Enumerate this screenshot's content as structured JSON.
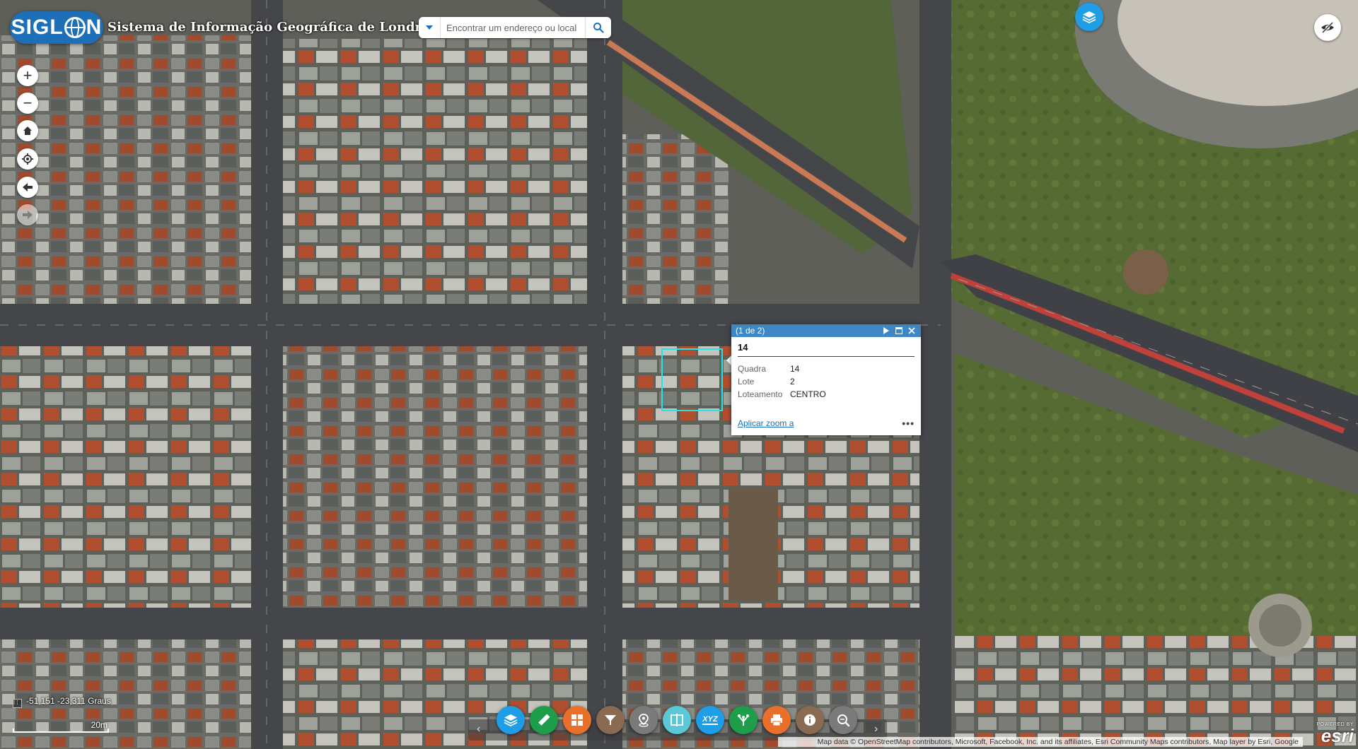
{
  "app": {
    "logo_text_left": "SIGL",
    "logo_text_right": "N",
    "title": "Sistema de Informação Geográfica de Londrina"
  },
  "search": {
    "placeholder": "Encontrar um endereço ou local",
    "value": ""
  },
  "nav": {
    "zoom_in": "+",
    "zoom_out": "−"
  },
  "popup": {
    "count": "(1 de 2)",
    "title": "14",
    "fields": [
      {
        "label": "Quadra",
        "value": "14"
      },
      {
        "label": "Lote",
        "value": "2"
      },
      {
        "label": "Loteamento",
        "value": "CENTRO"
      }
    ],
    "zoom_link": "Aplicar zoom a",
    "more": "•••"
  },
  "toolbar": {
    "colors": {
      "layers": "#1f9ee8",
      "measure": "#1e9d4a",
      "basemap": "#e8702a",
      "filter": "#8a6a50",
      "location": "#7a7a7a",
      "compare": "#5bc8d8",
      "xyz": "#1f9ee8",
      "share": "#1e9d4a",
      "print": "#e8702a",
      "info": "#8a6a50",
      "search": "#7a7a7a"
    },
    "xyz_label": "XYZ"
  },
  "status": {
    "coordinates": "-51,151 -23,311 Graus",
    "scale": "20m"
  },
  "attribution": "Map data © OpenStreetMap contributors, Microsoft, Facebook, Inc. and its affiliates, Esri Community Maps contributors, Map layer by Esri, Google",
  "esri": {
    "powered_by": "POWERED BY",
    "name": "esri"
  }
}
